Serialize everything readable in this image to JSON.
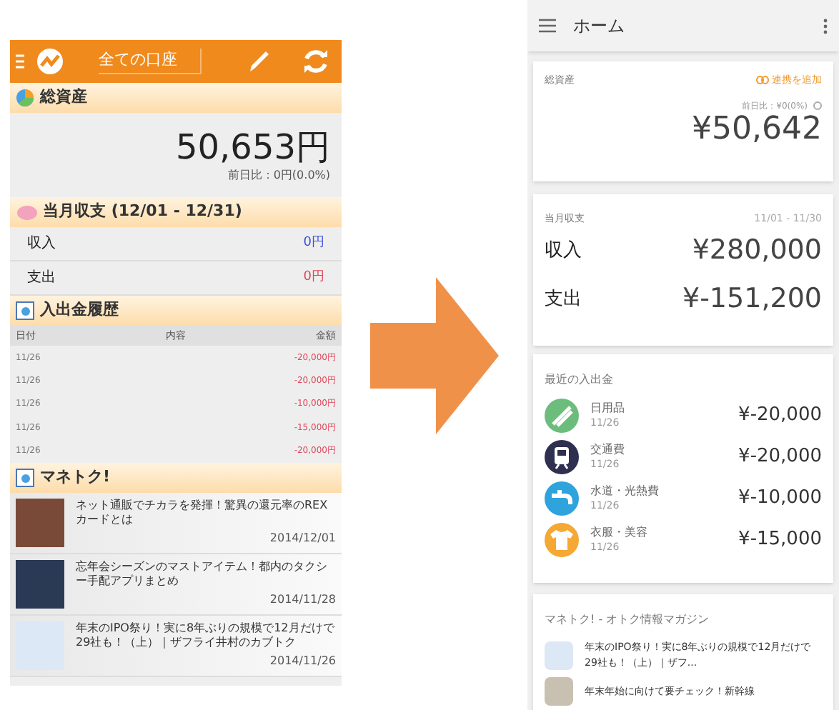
{
  "old_app": {
    "header": {
      "title": "全ての口座"
    },
    "total_assets": {
      "heading": "総資産",
      "amount": "50,653円",
      "change": "前日比：0円(0.0%)"
    },
    "monthly": {
      "heading": "当月収支 (12/01 - 12/31)",
      "rows": [
        {
          "label": "収入",
          "value": "0円",
          "color": "#3b4fd9"
        },
        {
          "label": "支出",
          "value": "0円",
          "color": "#e0455a"
        }
      ]
    },
    "history": {
      "heading": "入出金履歴",
      "columns": [
        "日付",
        "内容",
        "金額"
      ],
      "rows": [
        {
          "date": "11/26",
          "amount": "-20,000円"
        },
        {
          "date": "11/26",
          "amount": "-20,000円"
        },
        {
          "date": "11/26",
          "amount": "-10,000円"
        },
        {
          "date": "11/26",
          "amount": "-15,000円"
        },
        {
          "date": "11/26",
          "amount": "-20,000円"
        }
      ]
    },
    "articles": {
      "heading": "マネトク!",
      "items": [
        {
          "title": "ネット通販でチカラを発揮！驚異の還元率のREXカードとは",
          "date": "2014/12/01"
        },
        {
          "title": "忘年会シーズンのマストアイテム！都内のタクシー手配アプリまとめ",
          "date": "2014/11/28"
        },
        {
          "title": "年末のIPO祭り！実に8年ぶりの規模で12月だけで29社も！（上）｜ザフライ井村のカブトク",
          "date": "2014/11/26"
        }
      ]
    }
  },
  "new_app": {
    "top_bar": {
      "title": "ホーム"
    },
    "total_assets": {
      "heading": "総資産",
      "link": "連携を追加",
      "change": "前日比：¥0(0%)",
      "amount": "¥50,642"
    },
    "monthly": {
      "heading": "当月収支",
      "period": "11/01 - 11/30",
      "rows": [
        {
          "label": "収入",
          "value": "¥280,000"
        },
        {
          "label": "支出",
          "value": "¥-151,200"
        }
      ]
    },
    "recent": {
      "heading": "最近の入出金",
      "items": [
        {
          "category": "日用品",
          "date": "11/26",
          "amount": "¥-20,000",
          "color": "#6cbd7c",
          "kind": "brush"
        },
        {
          "category": "交通費",
          "date": "11/26",
          "amount": "¥-20,000",
          "color": "#2f2f50",
          "kind": "train"
        },
        {
          "category": "水道・光熱費",
          "date": "11/26",
          "amount": "¥-10,000",
          "color": "#2ea3dc",
          "kind": "tap"
        },
        {
          "category": "衣服・美容",
          "date": "11/26",
          "amount": "¥-15,000",
          "color": "#f5a833",
          "kind": "shirt"
        }
      ]
    },
    "magazine": {
      "heading": "マネトク! - オトク情報マガジン",
      "items": [
        {
          "title": "年末のIPO祭り！実に8年ぶりの規模で12月だけで29社も！（上）｜ザフ..."
        },
        {
          "title": "年末年始に向けて要チェック！新幹線"
        }
      ]
    }
  }
}
